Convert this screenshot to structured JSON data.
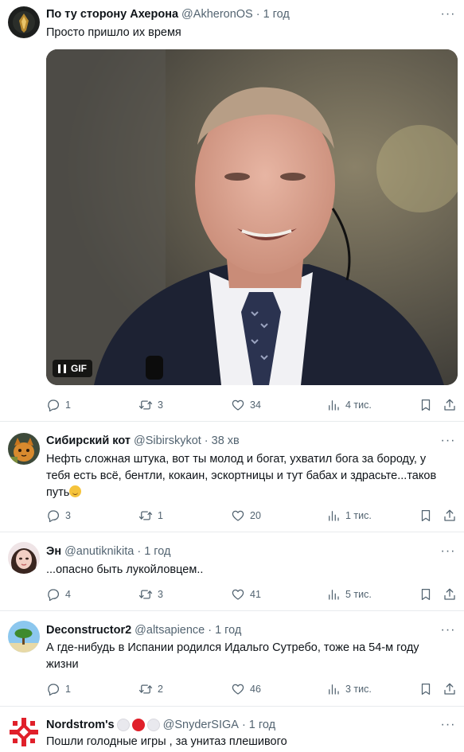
{
  "tweets": [
    {
      "name": "По ту сторону Ахерона",
      "handle": "@AkheronOS",
      "sep": "·",
      "time": "1 год",
      "text": "Просто пришло их время",
      "media_badge": "GIF",
      "replies": "1",
      "retweets": "3",
      "likes": "34",
      "views": "4 тис."
    },
    {
      "name": "Сибирский кот",
      "handle": "@Sibirskykot",
      "sep": "·",
      "time": "38 хв",
      "text": "Нефть сложная штука, вот ты молод и богат, ухватил бога за бороду, у тебя есть всё, бентли, кокаин, эскортницы и тут бабах и здрасьте...таков путь",
      "replies": "3",
      "retweets": "1",
      "likes": "20",
      "views": "1 тис."
    },
    {
      "name": "Эн",
      "handle": "@anutiknikita",
      "sep": "·",
      "time": "1 год",
      "text": "...опасно быть лукойловцем..",
      "replies": "4",
      "retweets": "3",
      "likes": "41",
      "views": "5 тис."
    },
    {
      "name": "Deconstructor2",
      "handle": "@altsapience",
      "sep": "·",
      "time": "1 год",
      "text": "А где-нибудь в Испании родился Идальго Сутребо, тоже на 54-м году жизни",
      "replies": "1",
      "retweets": "2",
      "likes": "46",
      "views": "3 тис."
    },
    {
      "name": "Nordstrom's",
      "handle": "@SnyderSIGA",
      "sep": "·",
      "time": "1 год",
      "text": "Пошли голодные игры , за унитаз плешивого"
    }
  ],
  "more_glyph": "···",
  "colors": {
    "text": "#0f1419",
    "secondary": "#536471",
    "divider": "#e8ebed"
  },
  "icons": [
    "reply-icon",
    "retweet-icon",
    "like-icon",
    "views-icon",
    "bookmark-icon",
    "share-icon",
    "more-icon",
    "pause-icon"
  ]
}
